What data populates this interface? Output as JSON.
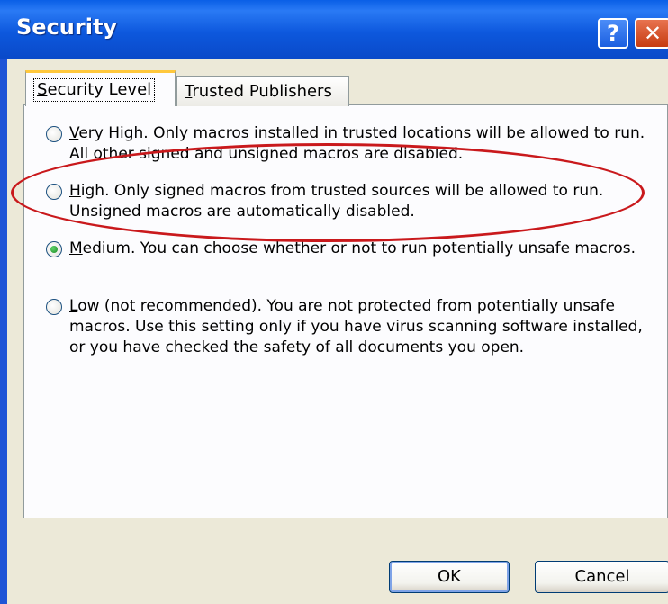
{
  "window": {
    "title": "Security",
    "help_glyph": "?",
    "close_glyph": "✕"
  },
  "tabs": [
    {
      "label_accel": "S",
      "label_rest": "ecurity Level",
      "active": true
    },
    {
      "label_accel": "T",
      "label_rest": "rusted Publishers",
      "active": false
    }
  ],
  "options": [
    {
      "accel": "V",
      "rest": "ery High. Only macros installed in trusted locations will be allowed to run. All other signed and unsigned macros are disabled.",
      "selected": false
    },
    {
      "accel": "H",
      "rest": "igh. Only signed macros from trusted sources will be allowed to run. Unsigned macros are automatically disabled.",
      "selected": false
    },
    {
      "accel": "M",
      "rest": "edium. You can choose whether or not to run potentially unsafe macros.",
      "selected": true
    },
    {
      "accel": "L",
      "rest": "ow (not recommended). You are not protected from potentially unsafe macros. Use this setting only if you have virus scanning software installed, or you have checked the safety of all documents you open.",
      "selected": false
    }
  ],
  "buttons": {
    "ok": "OK",
    "cancel": "Cancel"
  },
  "colors": {
    "title_bar": "#0a5fe6",
    "client_bg": "#ece9d8",
    "highlight_annotation": "#c9191c",
    "active_tab_accent": "#ffc83c"
  }
}
